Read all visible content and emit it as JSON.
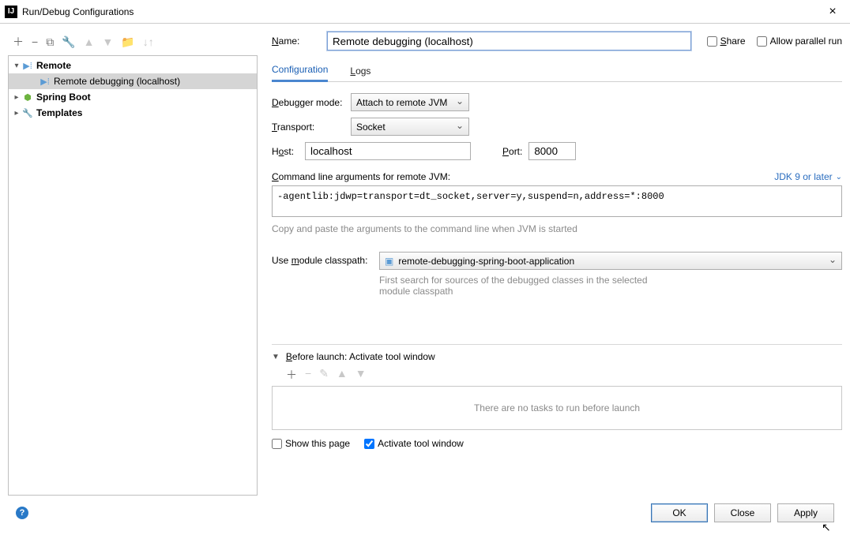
{
  "window": {
    "title": "Run/Debug Configurations"
  },
  "tree": {
    "remote": "Remote",
    "remote_child": "Remote debugging (localhost)",
    "spring": "Spring Boot",
    "templates": "Templates"
  },
  "form": {
    "name_label": "Name:",
    "name_value": "Remote debugging (localhost)",
    "share": "Share",
    "allow_parallel": "Allow parallel run"
  },
  "tabs": {
    "config": "Configuration",
    "logs": "Logs"
  },
  "config": {
    "debugger_mode_label": "Debugger mode:",
    "debugger_mode_value": "Attach to remote JVM",
    "transport_label": "Transport:",
    "transport_value": "Socket",
    "host_label": "Host:",
    "host_value": "localhost",
    "port_label": "Port:",
    "port_value": "8000",
    "cmdline_label": "Command line arguments for remote JVM:",
    "jdk_label": "JDK 9 or later",
    "cmdline_value": "-agentlib:jdwp=transport=dt_socket,server=y,suspend=n,address=*:8000",
    "cmdline_hint": "Copy and paste the arguments to the command line when JVM is started",
    "module_label": "Use module classpath:",
    "module_value": "remote-debugging-spring-boot-application",
    "module_hint": "First search for sources of the debugged classes in the selected module classpath"
  },
  "before_launch": {
    "title": "Before launch: Activate tool window",
    "empty": "There are no tasks to run before launch",
    "show_page": "Show this page",
    "activate": "Activate tool window"
  },
  "buttons": {
    "ok": "OK",
    "close": "Close",
    "apply": "Apply"
  }
}
